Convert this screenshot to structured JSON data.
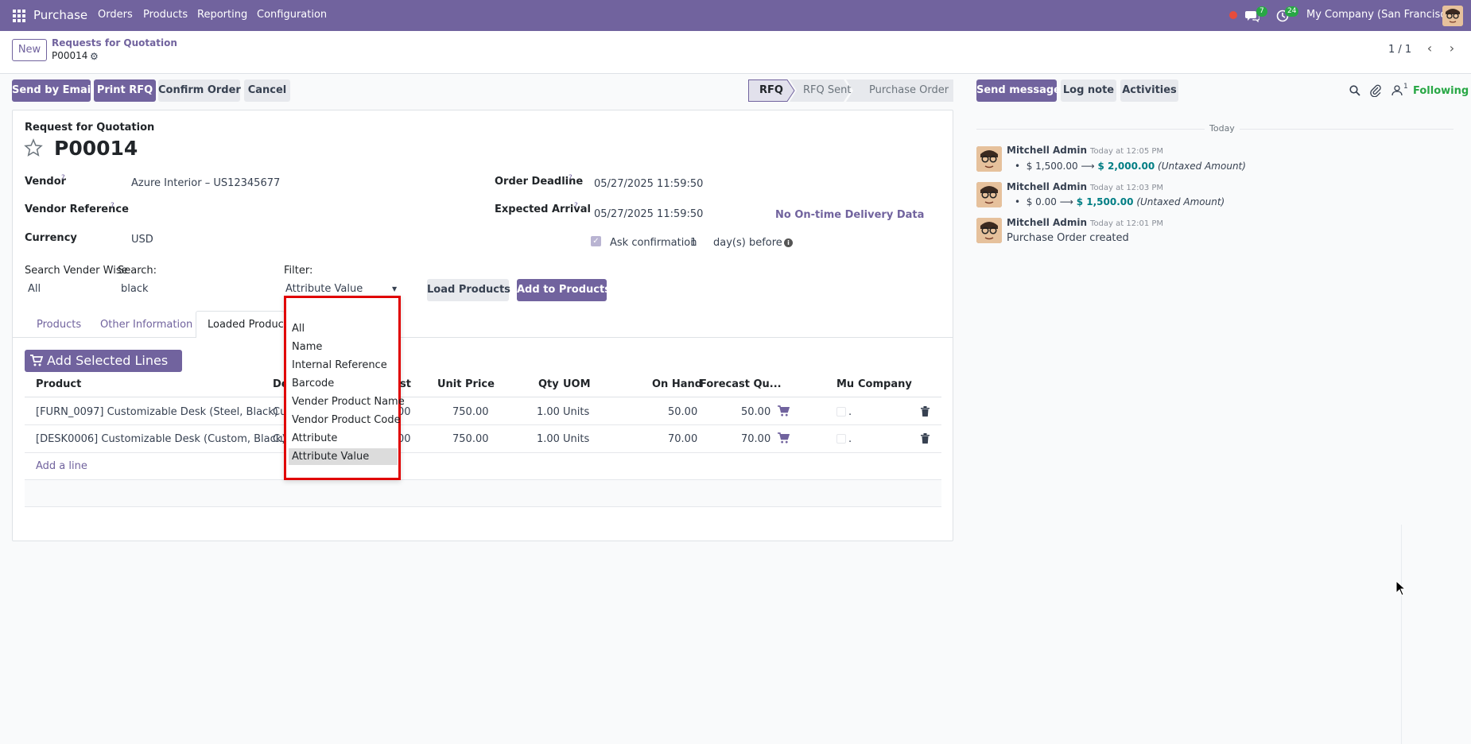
{
  "topbar": {
    "app_title": "Purchase",
    "menu": [
      "Orders",
      "Products",
      "Reporting",
      "Configuration"
    ],
    "messages_count": "7",
    "activities_count": "24",
    "company": "My Company (San Francisco)"
  },
  "control": {
    "new_label": "New",
    "breadcrumb_parent": "Requests for Quotation",
    "record_name": "P00014",
    "pager": "1 / 1"
  },
  "actions": {
    "send_email": "Send by Email",
    "print_rfq": "Print RFQ",
    "confirm": "Confirm Order",
    "cancel": "Cancel"
  },
  "statusbar": {
    "stages": [
      "RFQ",
      "RFQ Sent",
      "Purchase Order"
    ],
    "active": "RFQ"
  },
  "form": {
    "doc_type": "Request for Quotation",
    "name": "P00014",
    "vendor_label": "Vendor",
    "vendor": "Azure Interior – US12345677",
    "vendor_ref_label": "Vendor Reference",
    "currency_label": "Currency",
    "currency": "USD",
    "order_deadline_label": "Order Deadline",
    "order_deadline": "05/27/2025 11:59:50",
    "expected_arrival_label": "Expected Arrival",
    "expected_arrival": "05/27/2025 11:59:50",
    "ontime": "No On-time Delivery Data",
    "ask_confirmation_label": "Ask confirmation",
    "ask_days": "1",
    "days_before": "day(s) before",
    "search_vendor_label": "Search Vender Wise",
    "search_vendor_value": "All",
    "search_label": "Search:",
    "search_value": "black",
    "filter_label": "Filter:",
    "filter_value": "Attribute Value",
    "load_products": "Load Products",
    "add_to_products": "Add to Products"
  },
  "dropdown": {
    "options": [
      "All",
      "Name",
      "Internal Reference",
      "Barcode",
      "Vender Product Name",
      "Vendor Product Code",
      "Attribute",
      "Attribute Value"
    ],
    "selected": "Attribute Value"
  },
  "tabs": [
    "Products",
    "Other Information",
    "Loaded Products"
  ],
  "add_selected": "Add Selected Lines",
  "table": {
    "columns": [
      "Product",
      "De",
      "st",
      "Unit Price",
      "Qty",
      "UOM",
      "On Hand",
      "Forecast Qu...",
      "Mu",
      "Company"
    ],
    "rows": [
      {
        "product": "[FURN_0097] Customizable Desk (Steel, Black)",
        "desc": "Cu",
        "cost": "00",
        "unit_price": "750.00",
        "qty": "1.00",
        "uom": "Units",
        "on_hand": "50.00",
        "forecast": "50.00",
        "company": "."
      },
      {
        "product": "[DESK0006] Customizable Desk (Custom, Black)",
        "desc": "Cu",
        "cost": "00",
        "unit_price": "750.00",
        "qty": "1.00",
        "uom": "Units",
        "on_hand": "70.00",
        "forecast": "70.00",
        "company": "."
      }
    ],
    "add_line": "Add a line"
  },
  "chatter": {
    "send_message": "Send message",
    "log_note": "Log note",
    "activities": "Activities",
    "followers_count": "1",
    "following": "Following",
    "date_sep": "Today",
    "messages": [
      {
        "author": "Mitchell Admin",
        "time": "Today at 12:05 PM",
        "old": "$ 1,500.00",
        "new": "$ 2,000.00",
        "field": "(Untaxed Amount)"
      },
      {
        "author": "Mitchell Admin",
        "time": "Today at 12:03 PM",
        "old": "$ 0.00",
        "new": "$ 1,500.00",
        "field": "(Untaxed Amount)"
      },
      {
        "author": "Mitchell Admin",
        "time": "Today at 12:01 PM",
        "body": "Purchase Order created"
      }
    ]
  },
  "colors": {
    "brand": "#71639e",
    "accent": "#017e84",
    "dropdown_highlight": "#e00000"
  }
}
